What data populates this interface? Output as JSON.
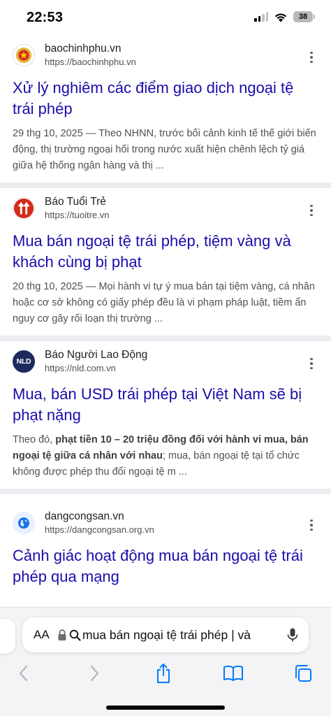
{
  "status_bar": {
    "time": "22:53",
    "battery": "38",
    "icons": [
      "signal-icon",
      "wifi-icon",
      "battery-icon"
    ]
  },
  "results": [
    {
      "site_name": "baochinhphu.vn",
      "url": "https://baochinhphu.vn",
      "icon": "vietnam-emblem-icon",
      "title": "Xử lý nghiêm các điểm giao dịch ngoại tệ trái phép",
      "snippet": "29 thg 10, 2025 — Theo NHNN, trước bối cảnh kinh tế thế giới biến động, thị trường ngoại hối trong nước xuất hiện chênh lệch tỷ giá giữa hệ thống ngân hàng và thị ..."
    },
    {
      "site_name": "Báo Tuổi Trẻ",
      "url": "https://tuoitre.vn",
      "icon": "tuoitre-logo-icon",
      "title": "Mua bán ngoại tệ trái phép, tiệm vàng và khách cùng bị phạt",
      "snippet": "20 thg 10, 2025 — Mọi hành vi tự ý mua bán tại tiệm vàng, cá nhân hoặc cơ sở không có giấy phép đều là vi phạm pháp luật, tiềm ẩn nguy cơ gây rối loạn thị trường ..."
    },
    {
      "site_name": "Báo Người Lao Động",
      "url": "https://nld.com.vn",
      "icon": "nld-logo-icon",
      "logo_text": "NLD",
      "title": "Mua, bán USD trái phép tại Việt Nam sẽ bị phạt nặng",
      "snippet_before": "Theo đó, ",
      "snippet_bold": "phạt tiền 10 – 20 triệu đồng đối với hành vi mua, bán ngoại tệ giữa cá nhân với nhau",
      "snippet_after": "; mua, bán ngoại tệ tại tổ chức không được phép thu đổi ngoại tệ m ..."
    },
    {
      "site_name": "dangcongsan.vn",
      "url": "https://dangcongsan.org.vn",
      "icon": "globe-icon",
      "title": "Cảnh giác hoạt động mua bán ngoại tệ trái phép qua mạng"
    }
  ],
  "safari": {
    "text_size_label": "AA",
    "search_query": "mua bán ngoại tệ trái phép | và",
    "toolbar": [
      "back-icon",
      "forward-icon",
      "share-icon",
      "bookmarks-icon",
      "tabs-icon"
    ]
  },
  "colors": {
    "link": "#1a0dab",
    "snippet": "#4d5156",
    "divider": "#ebedf0",
    "ios_blue": "#007aff"
  }
}
